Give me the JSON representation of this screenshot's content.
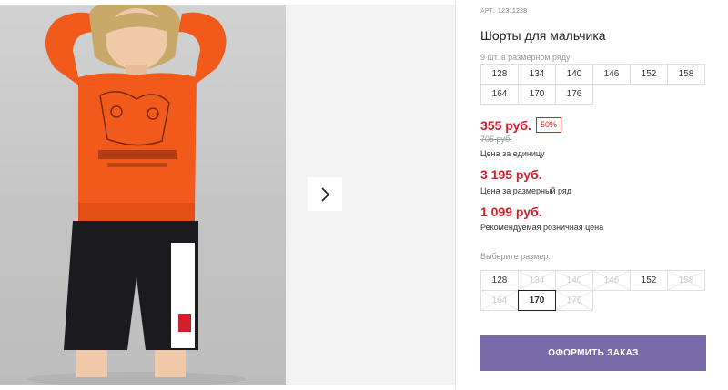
{
  "product": {
    "art_label": "АРТ:",
    "art_number": "12311228",
    "title": "Шорты для мальчика",
    "pack_info": "9 шт. в размерном ряду"
  },
  "series_sizes": [
    "128",
    "134",
    "140",
    "146",
    "152",
    "158",
    "164",
    "170",
    "176"
  ],
  "prices": {
    "unit_price": "355 руб.",
    "discount": "50%",
    "old_price": "705 руб.",
    "unit_label": "Цена за единицу",
    "series_price": "3 195 руб.",
    "series_label": "Цена за размерный ряд",
    "retail_price": "1 099 руб.",
    "retail_label": "Рекомендуемая розничная цена"
  },
  "size_select": {
    "label": "Выберите размер:",
    "options": [
      {
        "size": "128",
        "available": true,
        "selected": false
      },
      {
        "size": "134",
        "available": false,
        "selected": false
      },
      {
        "size": "140",
        "available": false,
        "selected": false
      },
      {
        "size": "146",
        "available": false,
        "selected": false
      },
      {
        "size": "152",
        "available": true,
        "selected": false
      },
      {
        "size": "158",
        "available": false,
        "selected": false
      },
      {
        "size": "164",
        "available": false,
        "selected": false
      },
      {
        "size": "170",
        "available": true,
        "selected": true
      },
      {
        "size": "176",
        "available": false,
        "selected": false
      }
    ]
  },
  "actions": {
    "order_button": "ОФОРМИТЬ ЗАКАЗ",
    "next_icon": "chevron-right-icon"
  },
  "colors": {
    "price_red": "#d0202e",
    "order_button": "#7a69a8",
    "sweatshirt": "#f25a1b",
    "shorts": "#1a1a1f"
  }
}
